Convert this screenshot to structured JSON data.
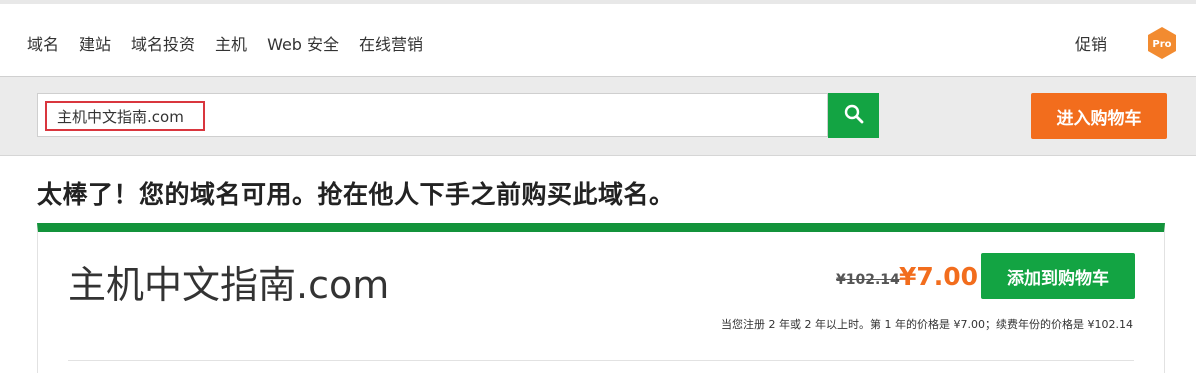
{
  "nav": {
    "items": [
      {
        "label": "域名"
      },
      {
        "label": "建站"
      },
      {
        "label": "域名投资"
      },
      {
        "label": "主机"
      },
      {
        "label": "Web 安全"
      },
      {
        "label": "在线营销"
      }
    ],
    "promo_label": "促销",
    "pro_badge": "Pro"
  },
  "search": {
    "value": "主机中文指南.com",
    "button_icon": "search-icon"
  },
  "cart_button_label": "进入购物车",
  "headline": "太棒了！您的域名可用。抢在他人下手之前购买此域名。",
  "result": {
    "domain": "主机中文指南.com",
    "old_price": "¥102.14",
    "new_price": "¥7.00",
    "add_button_label": "添加到购物车",
    "note": "当您注册 2 年或 2 年以上时。第 1 年的价格是 ¥7.00；续费年份的价格是 ¥102.14"
  },
  "colors": {
    "accent_orange": "#f26d1d",
    "accent_green": "#13a443",
    "search_highlight": "#d9363e"
  }
}
